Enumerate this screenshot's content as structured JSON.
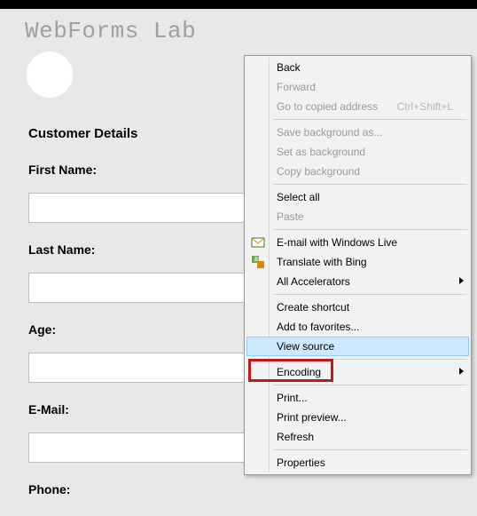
{
  "header": {
    "site_title": "WebForms Lab"
  },
  "form": {
    "section_title": "Customer Details",
    "fields": {
      "first_name": {
        "label": "First Name:",
        "value": ""
      },
      "last_name": {
        "label": "Last Name:",
        "value": ""
      },
      "age": {
        "label": "Age:",
        "value": ""
      },
      "email": {
        "label": "E-Mail:",
        "value": ""
      },
      "phone": {
        "label": "Phone:",
        "value": ""
      }
    }
  },
  "context_menu": {
    "items": {
      "back": {
        "label": "Back"
      },
      "forward": {
        "label": "Forward"
      },
      "copied_addr": {
        "label": "Go to copied address",
        "shortcut": "Ctrl+Shift+L"
      },
      "save_bg": {
        "label": "Save background as..."
      },
      "set_bg": {
        "label": "Set as background"
      },
      "copy_bg": {
        "label": "Copy background"
      },
      "select_all": {
        "label": "Select all"
      },
      "paste": {
        "label": "Paste"
      },
      "email_live": {
        "label": "E-mail with Windows Live"
      },
      "translate": {
        "label": "Translate with Bing"
      },
      "accelerators": {
        "label": "All Accelerators"
      },
      "shortcut": {
        "label": "Create shortcut"
      },
      "favorites": {
        "label": "Add to favorites..."
      },
      "view_source": {
        "label": "View source"
      },
      "encoding": {
        "label": "Encoding"
      },
      "print": {
        "label": "Print..."
      },
      "preview": {
        "label": "Print preview..."
      },
      "refresh": {
        "label": "Refresh"
      },
      "properties": {
        "label": "Properties"
      }
    }
  }
}
